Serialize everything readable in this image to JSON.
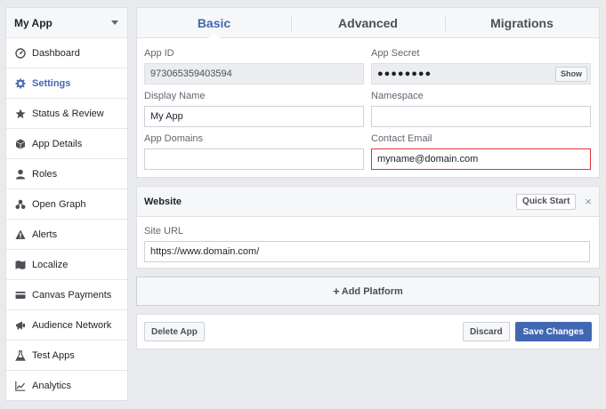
{
  "app_selector": {
    "name": "My App"
  },
  "sidebar": {
    "items": [
      {
        "label": "Dashboard",
        "icon": "dashboard-icon",
        "active": false
      },
      {
        "label": "Settings",
        "icon": "gear-icon",
        "active": true
      },
      {
        "label": "Status & Review",
        "icon": "star-icon",
        "active": false
      },
      {
        "label": "App Details",
        "icon": "cube-icon",
        "active": false
      },
      {
        "label": "Roles",
        "icon": "person-icon",
        "active": false
      },
      {
        "label": "Open Graph",
        "icon": "graph-icon",
        "active": false
      },
      {
        "label": "Alerts",
        "icon": "warning-icon",
        "active": false
      },
      {
        "label": "Localize",
        "icon": "map-icon",
        "active": false
      },
      {
        "label": "Canvas Payments",
        "icon": "credit-card-icon",
        "active": false
      },
      {
        "label": "Audience Network",
        "icon": "megaphone-icon",
        "active": false
      },
      {
        "label": "Test Apps",
        "icon": "flask-icon",
        "active": false
      },
      {
        "label": "Analytics",
        "icon": "chart-icon",
        "active": false
      }
    ]
  },
  "tabs": [
    {
      "label": "Basic",
      "active": true
    },
    {
      "label": "Advanced",
      "active": false
    },
    {
      "label": "Migrations",
      "active": false
    }
  ],
  "basic": {
    "app_id": {
      "label": "App ID",
      "value": "973065359403594"
    },
    "app_secret": {
      "label": "App Secret",
      "value": "●●●●●●●●",
      "show_label": "Show"
    },
    "display_name": {
      "label": "Display Name",
      "value": "My App"
    },
    "namespace": {
      "label": "Namespace",
      "value": ""
    },
    "app_domains": {
      "label": "App Domains",
      "value": ""
    },
    "contact_email": {
      "label": "Contact Email",
      "value": "myname@domain.com"
    }
  },
  "website": {
    "title": "Website",
    "quick_start_label": "Quick Start",
    "close_glyph": "×",
    "site_url": {
      "label": "Site URL",
      "value": "https://www.domain.com/"
    }
  },
  "add_platform": {
    "plus": "+",
    "label": "Add Platform"
  },
  "actions": {
    "delete_label": "Delete App",
    "discard_label": "Discard",
    "save_label": "Save Changes"
  },
  "colors": {
    "accent": "#4267b2",
    "error_border": "#e5323c",
    "background": "#e9eaed"
  }
}
